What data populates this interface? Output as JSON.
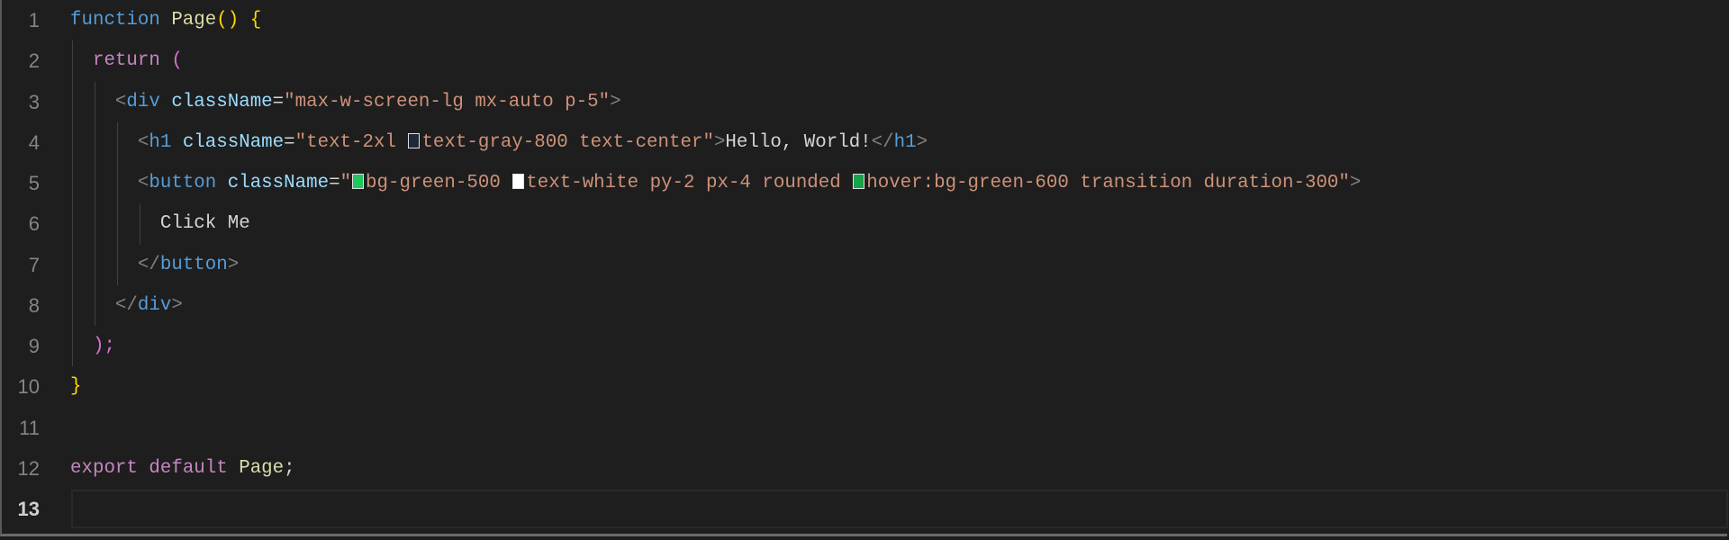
{
  "editor": {
    "active_line": 13,
    "colors": {
      "background": "#1e1e1e",
      "keyword": "#569cd6",
      "control": "#c586c0",
      "function": "#dcdcaa",
      "string": "#ce9178",
      "attribute": "#9cdcfe"
    },
    "lines": [
      {
        "n": "1",
        "indent": 0,
        "tokens": [
          {
            "t": "function ",
            "c": "kw"
          },
          {
            "t": "Page",
            "c": "fn"
          },
          {
            "t": "()",
            "c": "br1"
          },
          {
            "t": " ",
            "c": "txt"
          },
          {
            "t": "{",
            "c": "br1"
          }
        ]
      },
      {
        "n": "2",
        "indent": 1,
        "tokens": [
          {
            "t": "return ",
            "c": "ctl"
          },
          {
            "t": "(",
            "c": "br2"
          }
        ]
      },
      {
        "n": "3",
        "indent": 2,
        "tokens": [
          {
            "t": "<",
            "c": "punc"
          },
          {
            "t": "div",
            "c": "tag"
          },
          {
            "t": " className",
            "c": "attr"
          },
          {
            "t": "=",
            "c": "op"
          },
          {
            "t": "\"max-w-screen-lg mx-auto p-5\"",
            "c": "str"
          },
          {
            "t": ">",
            "c": "punc"
          }
        ]
      },
      {
        "n": "4",
        "indent": 3,
        "tokens": [
          {
            "t": "<",
            "c": "punc"
          },
          {
            "t": "h1",
            "c": "tag"
          },
          {
            "t": " className",
            "c": "attr"
          },
          {
            "t": "=",
            "c": "op"
          },
          {
            "t": "\"text-2xl ",
            "c": "str"
          },
          {
            "swatch": "#1f2937"
          },
          {
            "t": "text-gray-800 text-center\"",
            "c": "str"
          },
          {
            "t": ">",
            "c": "punc"
          },
          {
            "t": "Hello, World!",
            "c": "txt"
          },
          {
            "t": "</",
            "c": "punc"
          },
          {
            "t": "h1",
            "c": "tag"
          },
          {
            "t": ">",
            "c": "punc"
          }
        ]
      },
      {
        "n": "5",
        "indent": 3,
        "tokens": [
          {
            "t": "<",
            "c": "punc"
          },
          {
            "t": "button",
            "c": "tag"
          },
          {
            "t": " className",
            "c": "attr"
          },
          {
            "t": "=",
            "c": "op"
          },
          {
            "t": "\"",
            "c": "str"
          },
          {
            "swatch": "#22c55e"
          },
          {
            "t": "bg-green-500 ",
            "c": "str"
          },
          {
            "swatch": "#ffffff"
          },
          {
            "t": "text-white py-2 px-4 rounded ",
            "c": "str"
          },
          {
            "swatch": "#16a34a"
          },
          {
            "t": "hover:bg-green-600 transition duration-300\"",
            "c": "str"
          },
          {
            "t": ">",
            "c": "punc"
          }
        ]
      },
      {
        "n": "6",
        "indent": 4,
        "tokens": [
          {
            "t": "Click Me",
            "c": "txt"
          }
        ]
      },
      {
        "n": "7",
        "indent": 3,
        "tokens": [
          {
            "t": "</",
            "c": "punc"
          },
          {
            "t": "button",
            "c": "tag"
          },
          {
            "t": ">",
            "c": "punc"
          }
        ]
      },
      {
        "n": "8",
        "indent": 2,
        "tokens": [
          {
            "t": "</",
            "c": "punc"
          },
          {
            "t": "div",
            "c": "tag"
          },
          {
            "t": ">",
            "c": "punc"
          }
        ]
      },
      {
        "n": "9",
        "indent": 1,
        "tokens": [
          {
            "t": ");",
            "c": "br2"
          }
        ]
      },
      {
        "n": "10",
        "indent": 0,
        "tokens": [
          {
            "t": "}",
            "c": "br1"
          }
        ]
      },
      {
        "n": "11",
        "indent": 0,
        "tokens": []
      },
      {
        "n": "12",
        "indent": 0,
        "tokens": [
          {
            "t": "export ",
            "c": "ctl"
          },
          {
            "t": "default ",
            "c": "ctl"
          },
          {
            "t": "Page",
            "c": "fn"
          },
          {
            "t": ";",
            "c": "txt"
          }
        ]
      },
      {
        "n": "13",
        "indent": 0,
        "tokens": []
      }
    ]
  }
}
